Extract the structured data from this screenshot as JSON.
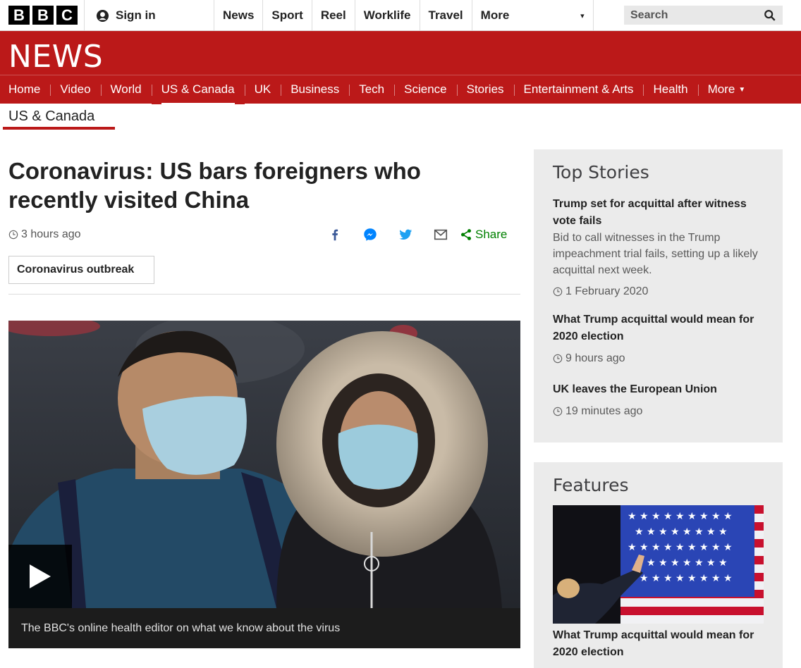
{
  "brand": {
    "letters": [
      "B",
      "B",
      "C"
    ]
  },
  "topbar": {
    "signin_label": "Sign in",
    "nav": [
      "News",
      "Sport",
      "Reel",
      "Worklife",
      "Travel"
    ],
    "more_label": "More",
    "search_label": "Search"
  },
  "news": {
    "title": "NEWS",
    "subnav": [
      "Home",
      "Video",
      "World",
      "US & Canada",
      "UK",
      "Business",
      "Tech",
      "Science",
      "Stories",
      "Entertainment & Arts",
      "Health"
    ],
    "subnav_more": "More",
    "active_index": 3
  },
  "section": {
    "label": "US & Canada"
  },
  "article": {
    "headline": "Coronavirus: US bars foreigners who recently visited China",
    "time": "3 hours ago",
    "share_label": "Share",
    "tag": "Coronavirus outbreak",
    "caption": "The BBC's online health editor on what we know about the virus"
  },
  "top_stories": {
    "title": "Top Stories",
    "items": [
      {
        "headline": "Trump set for acquittal after witness vote fails",
        "summary": "Bid to call witnesses in the Trump impeachment trial fails, setting up a likely acquittal next week.",
        "time": "1 February 2020"
      },
      {
        "headline": "What Trump acquittal would mean for 2020 election",
        "time": "9 hours ago"
      },
      {
        "headline": "UK leaves the European Union",
        "time": "19 minutes ago"
      }
    ]
  },
  "features": {
    "title": "Features",
    "headline": "What Trump acquittal would mean for 2020 election"
  },
  "colors": {
    "brand_red": "#bb1919",
    "share_green": "#008000",
    "facebook": "#3b5998",
    "messenger": "#0084ff",
    "twitter": "#1da1f2"
  }
}
